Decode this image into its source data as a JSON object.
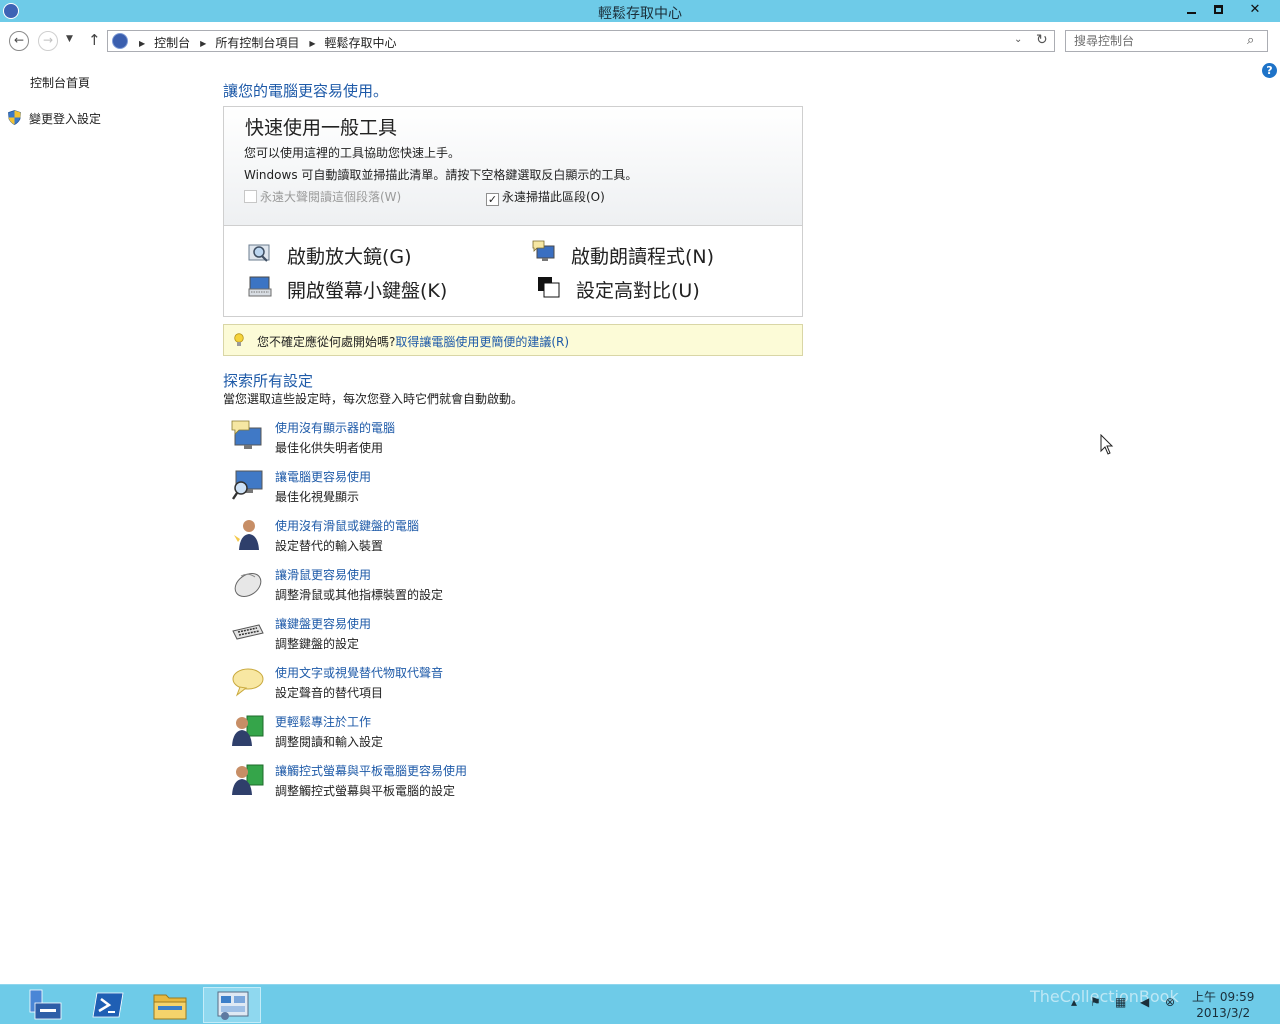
{
  "window": {
    "title": "輕鬆存取中心"
  },
  "addressbar": {
    "crumbs": [
      "控制台",
      "所有控制台項目",
      "輕鬆存取中心"
    ],
    "search_placeholder": "搜尋控制台"
  },
  "sidebar": {
    "home_link": "控制台首頁",
    "login_settings_link": "變更登入設定"
  },
  "main": {
    "heading": "讓您的電腦更容易使用。",
    "quick": {
      "title": "快速使用一般工具",
      "line1": "您可以使用這裡的工具協助您快速上手。",
      "line2": "Windows 可自動讀取並掃描此清單。請按下空格鍵選取反白顯示的工具。",
      "checkbox_read": {
        "label": "永遠大聲閱讀這個段落(W)",
        "checked": false,
        "enabled": false
      },
      "checkbox_scan": {
        "label": "永遠掃描此區段(O)",
        "checked": true,
        "enabled": true
      },
      "tools": [
        {
          "label": "啟動放大鏡(G)",
          "icon": "magnifier-icon"
        },
        {
          "label": "啟動朗讀程式(N)",
          "icon": "narrator-icon"
        },
        {
          "label": "開啟螢幕小鍵盤(K)",
          "icon": "onscreen-keyboard-icon"
        },
        {
          "label": "設定高對比(U)",
          "icon": "high-contrast-icon"
        }
      ]
    },
    "tip": {
      "text": "您不確定應從何處開始嗎?",
      "link": "取得讓電腦使用更簡便的建議(R)"
    },
    "explore": {
      "title": "探索所有設定",
      "subtitle": "當您選取這些設定時，每次您登入時它們就會自動啟動。",
      "items": [
        {
          "link": "使用沒有顯示器的電腦",
          "desc": "最佳化供失明者使用",
          "icon": "monitor-speech-icon"
        },
        {
          "link": "讓電腦更容易使用",
          "desc": "最佳化視覺顯示",
          "icon": "monitor-magnifier-icon"
        },
        {
          "link": "使用沒有滑鼠或鍵盤的電腦",
          "desc": "設定替代的輸入裝置",
          "icon": "person-icon"
        },
        {
          "link": "讓滑鼠更容易使用",
          "desc": "調整滑鼠或其他指標裝置的設定",
          "icon": "mouse-icon"
        },
        {
          "link": "讓鍵盤更容易使用",
          "desc": "調整鍵盤的設定",
          "icon": "keyboard-icon"
        },
        {
          "link": "使用文字或視覺替代物取代聲音",
          "desc": "設定聲音的替代項目",
          "icon": "speech-bubble-icon"
        },
        {
          "link": "更輕鬆專注於工作",
          "desc": "調整閱讀和輸入設定",
          "icon": "person-focus-icon"
        },
        {
          "link": "讓觸控式螢幕與平板電腦更容易使用",
          "desc": "調整觸控式螢幕與平板電腦的設定",
          "icon": "person-tablet-icon"
        }
      ]
    }
  },
  "taskbar": {
    "clock_time": "上午 09:59",
    "clock_date": "2013/3/2",
    "watermark": "TheCollectionBook"
  },
  "colors": {
    "accent": "#1e5aa8",
    "titlebar": "#6ecbe8",
    "tip_bg": "#fcfbd7"
  }
}
